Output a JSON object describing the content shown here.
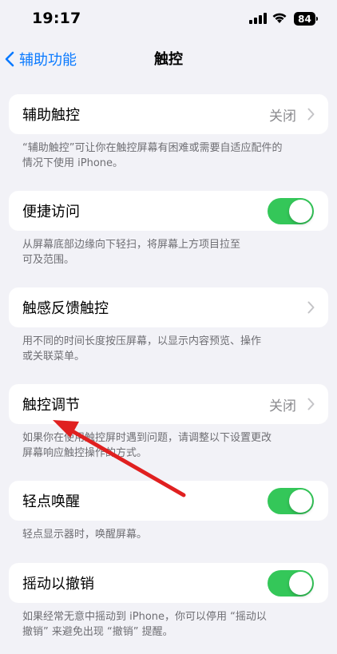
{
  "status_bar": {
    "time": "19:17",
    "battery": "84"
  },
  "nav": {
    "back_label": "辅助功能",
    "title": "触控"
  },
  "sections": [
    {
      "label": "辅助触控",
      "value": "关闭",
      "control": "chevron",
      "footer_lines": [
        "“辅助触控”可让你在触控屏幕有困难或需要自适应配件的",
        "情况下使用 iPhone。"
      ]
    },
    {
      "label": "便捷访问",
      "control": "toggle",
      "on": true,
      "footer_lines": [
        "从屏幕底部边缘向下轻扫，将屏幕上方项目拉至",
        "可及范围。"
      ]
    },
    {
      "label": "触感反馈触控",
      "control": "chevron",
      "footer_lines": [
        "用不同的时间长度按压屏幕，以显示内容预览、操作",
        "或关联菜单。"
      ]
    },
    {
      "label": "触控调节",
      "value": "关闭",
      "control": "chevron",
      "footer_lines": [
        "如果你在使用触控屏时遇到问题，请调整以下设置更改",
        "屏幕响应触控操作的方式。"
      ]
    },
    {
      "label": "轻点唤醒",
      "control": "toggle",
      "on": true,
      "footer_lines": [
        "轻点显示器时，唤醒屏幕。"
      ]
    },
    {
      "label": "摇动以撤销",
      "control": "toggle",
      "on": true,
      "footer_lines": [
        "如果经常无意中摇动到 iPhone，你可以停用 “摇动以",
        "撤销” 来避免出现 “撤销” 提醒。"
      ]
    }
  ],
  "colors": {
    "accent": "#0a7aff",
    "toggle_on": "#34c759",
    "annotation_arrow": "#e02020"
  }
}
